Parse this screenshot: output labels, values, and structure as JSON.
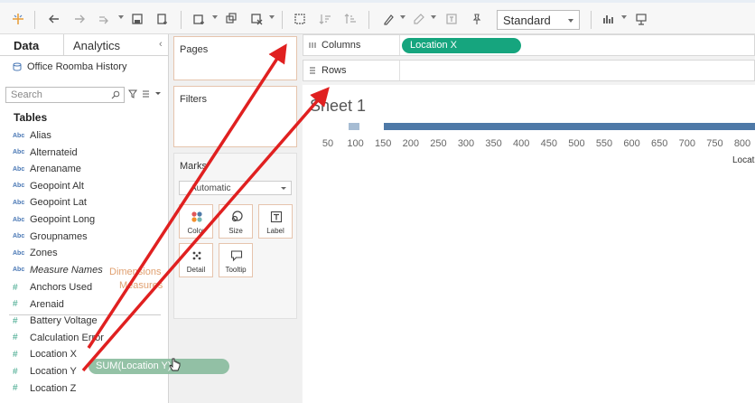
{
  "toolbar": {
    "view_mode": "Standard",
    "icons": [
      "tableau-logo-icon",
      "back-icon",
      "forward-icon",
      "redo-icon",
      "save-icon",
      "new-datasource-icon",
      "new-worksheet-icon",
      "duplicate-icon",
      "clear-icon",
      "swap-icon",
      "sort-asc-icon",
      "sort-desc-icon",
      "highlight-icon",
      "annotate-icon",
      "label-icon",
      "pin-icon",
      "show-me-icon",
      "presentation-icon"
    ]
  },
  "datapane": {
    "tab_data": "Data",
    "tab_analytics": "Analytics",
    "datasource": "Office Roomba History",
    "search_placeholder": "Search",
    "tables_header": "Tables",
    "dimensions": [
      {
        "type": "Abc",
        "name": "Alias"
      },
      {
        "type": "Abc",
        "name": "Alternateid"
      },
      {
        "type": "Abc",
        "name": "Arenaname"
      },
      {
        "type": "Abc",
        "name": "Geopoint Alt"
      },
      {
        "type": "Abc",
        "name": "Geopoint Lat"
      },
      {
        "type": "Abc",
        "name": "Geopoint Long"
      },
      {
        "type": "Abc",
        "name": "Groupnames"
      },
      {
        "type": "Abc",
        "name": "Zones"
      },
      {
        "type": "Abc",
        "name": "Measure Names"
      }
    ],
    "measures": [
      {
        "type": "#",
        "name": "Anchors Used"
      },
      {
        "type": "#",
        "name": "Arenaid"
      },
      {
        "type": "#",
        "name": "Battery Voltage"
      },
      {
        "type": "#",
        "name": "Calculation Error"
      },
      {
        "type": "#",
        "name": "Location X"
      },
      {
        "type": "#",
        "name": "Location Y"
      },
      {
        "type": "#",
        "name": "Location Z"
      }
    ],
    "drop_hint_dimensions": "Dimensions",
    "drop_hint_measures": "Measures"
  },
  "shelves": {
    "pages": "Pages",
    "filters": "Filters",
    "marks": "Marks",
    "marks_type": "Automatic",
    "mark_buttons": {
      "color": "Color",
      "size": "Size",
      "label": "Label",
      "detail": "Detail",
      "tooltip": "Tooltip"
    },
    "columns": "Columns",
    "rows": "Rows",
    "columns_pill": "Location X"
  },
  "canvas": {
    "sheet_title": "Sheet 1",
    "axis_ticks": [
      "50",
      "100",
      "150",
      "200",
      "250",
      "300",
      "350",
      "400",
      "450",
      "500",
      "550",
      "600",
      "650",
      "700",
      "750",
      "800"
    ],
    "axis_title_partial": "Locat"
  },
  "drag": {
    "pill_label": "SUM(Location Y)"
  },
  "colors": {
    "measure_pill": "#16a57e",
    "bar": "#4e79a7",
    "arrow": "#e02020",
    "card_border": "#e6c4ad"
  }
}
